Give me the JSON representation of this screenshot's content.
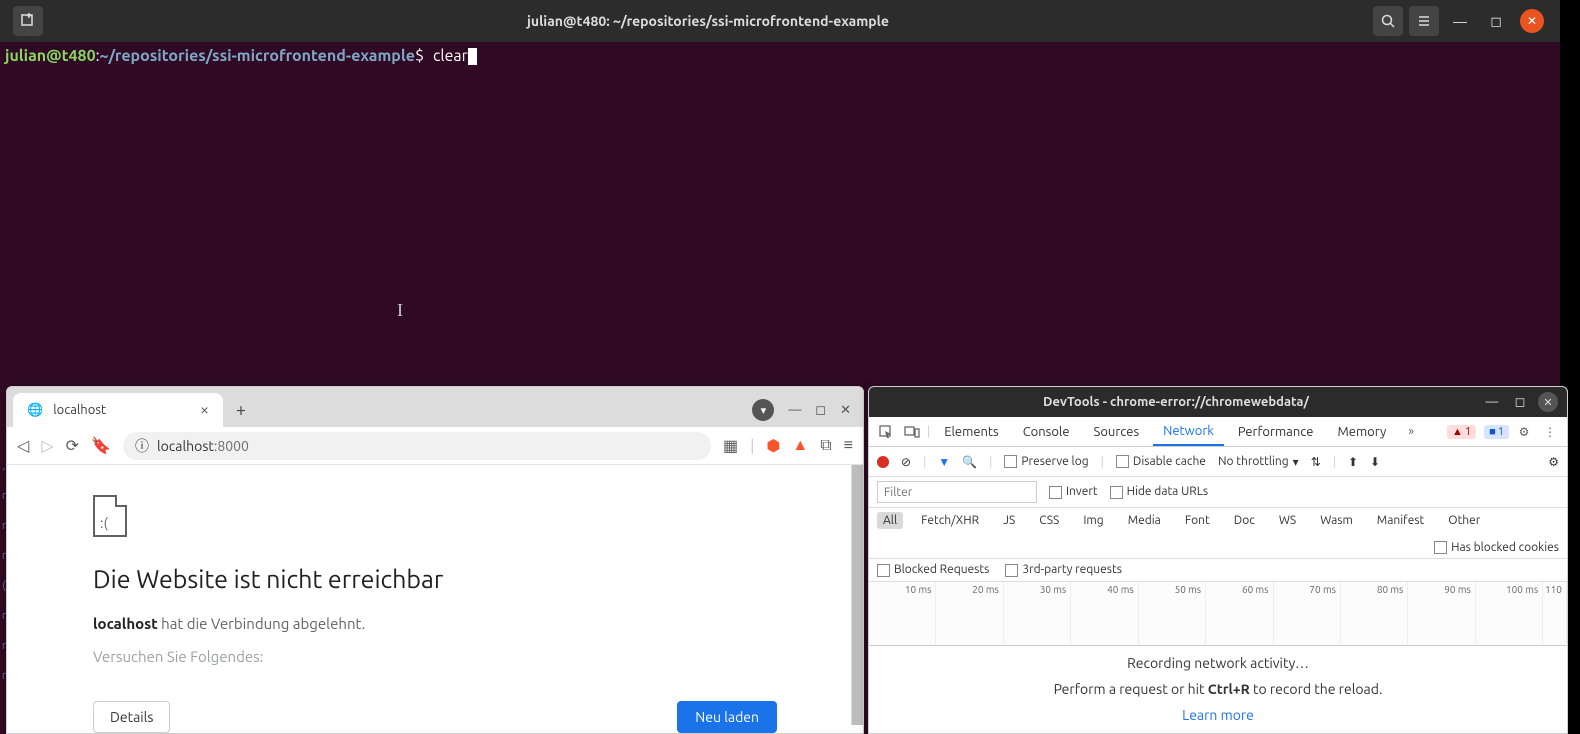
{
  "terminal": {
    "title": "julian@t480: ~/repositories/ssi-microfrontend-example",
    "prompt_user": "julian@t480",
    "prompt_colon": ":",
    "prompt_path": "~/repositories/ssi-microfrontend-example",
    "prompt_sym": "$",
    "command": "clear"
  },
  "browser": {
    "tab_title": "localhost",
    "url_prefix": "localhost",
    "url_suffix": ":8000",
    "error_heading": "Die Website ist nicht erreichbar",
    "error_host": "localhost",
    "error_host_suffix": " hat die Verbindung abgelehnt.",
    "error_suggest": "Versuchen Sie Folgendes:",
    "btn_details": "Details",
    "btn_reload": "Neu laden"
  },
  "devtools": {
    "title": "DevTools - chrome-error://chromewebdata/",
    "tabs": [
      "Elements",
      "Console",
      "Sources",
      "Network",
      "Performance",
      "Memory"
    ],
    "active_tab": "Network",
    "warn_count": "1",
    "info_count": "1",
    "preserve_log": "Preserve log",
    "disable_cache": "Disable cache",
    "throttling": "No throttling",
    "filter_placeholder": "Filter",
    "invert": "Invert",
    "hide_urls": "Hide data URLs",
    "types": [
      "All",
      "Fetch/XHR",
      "JS",
      "CSS",
      "Img",
      "Media",
      "Font",
      "Doc",
      "WS",
      "Wasm",
      "Manifest",
      "Other"
    ],
    "blocked_cookies": "Has blocked cookies",
    "blocked_req": "Blocked Requests",
    "third_party": "3rd-party requests",
    "ticks": [
      "10 ms",
      "20 ms",
      "30 ms",
      "40 ms",
      "50 ms",
      "60 ms",
      "70 ms",
      "80 ms",
      "90 ms",
      "100 ms",
      "110"
    ],
    "recording": "Recording network activity…",
    "hint_pre": "Perform a request or hit ",
    "hint_key": "Ctrl+R",
    "hint_post": " to record the reload.",
    "learn": "Learn more"
  }
}
